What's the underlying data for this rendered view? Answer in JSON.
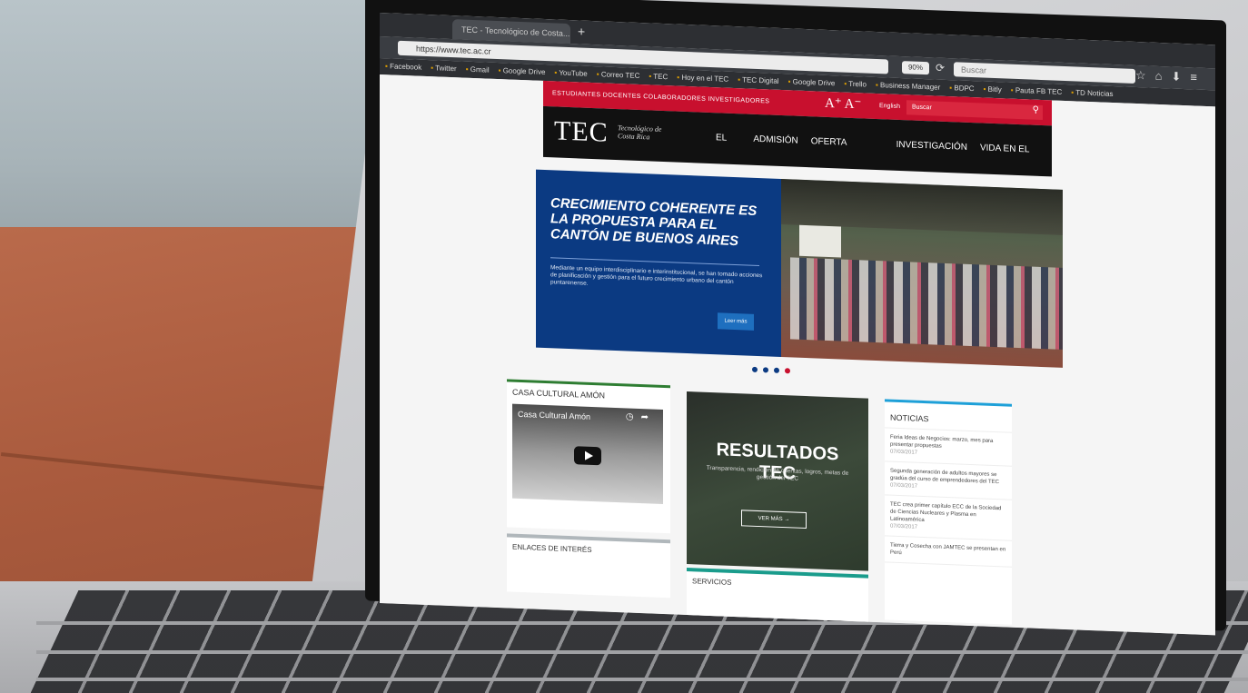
{
  "browser": {
    "tab_title": "TEC - Tecnológico de Costa...",
    "url": "https://www.tec.ac.cr",
    "zoom": "90%",
    "search_placeholder": "Buscar",
    "bookmarks": [
      "Facebook",
      "Twitter",
      "Gmail",
      "Google Drive",
      "YouTube",
      "Correo TEC",
      "TEC",
      "Hoy en el TEC",
      "TEC Digital",
      "Google Drive",
      "Trello",
      "Business Manager",
      "BDPC",
      "Bitly",
      "Pauta FB TEC",
      "TD Noticias"
    ]
  },
  "tec": {
    "top_nav": "ESTUDIANTES   DOCENTES   COLABORADORES   INVESTIGADORES",
    "font_size_controls": "A⁺ A⁻",
    "language": "English",
    "search_placeholder": "Buscar",
    "logo": "TEC",
    "logo_subtitle": "Tecnológico de Costa Rica",
    "main_nav": [
      "EL TEC",
      "ADMISIÓN",
      "OFERTA ACADÉMICA",
      "INVESTIGACIÓN",
      "VIDA EN EL CAMPUS"
    ],
    "hero": {
      "title": "CRECIMIENTO COHERENTE ES LA PROPUESTA PARA EL CANTÓN DE BUENOS AIRES",
      "body": "Mediante un equipo interdisciplinario e interinstitucional, se han tomado acciones de planificación y gestión para el futuro crecimiento urbano del cantón puntarenense.",
      "button": "Leer más"
    },
    "amon": {
      "title": "CASA CULTURAL AMÓN",
      "video_title": "Casa Cultural Amón"
    },
    "results": {
      "title": "RESULTADOS TEC",
      "subtitle": "Transparencia, rendición de cuentas, logros, metas de gestión del TEC",
      "button": "VER MÁS →"
    },
    "news": {
      "title": "NOTICIAS",
      "items": [
        {
          "text": "Feria Ideas de Negocios: marzo, mes para presentar propuestas",
          "date": "07/03/2017"
        },
        {
          "text": "Segunda generación de adultos mayores se gradúa del curso de emprendedores del TEC",
          "date": "07/03/2017"
        },
        {
          "text": "TEC crea primer capítulo ECC de la Sociedad de Ciencias Nucleares y Plasma en Latinoamérica",
          "date": "07/03/2017"
        },
        {
          "text": "Tierra y Cosecha con JAMTEC se presentan en Perú",
          "date": ""
        }
      ]
    },
    "enlaces_title": "ENLACES DE INTERÉS",
    "servicios_title": "SERVICIOS"
  },
  "colors": {
    "red": "#c8102e",
    "blue": "#0b3a82",
    "black": "#111111"
  }
}
